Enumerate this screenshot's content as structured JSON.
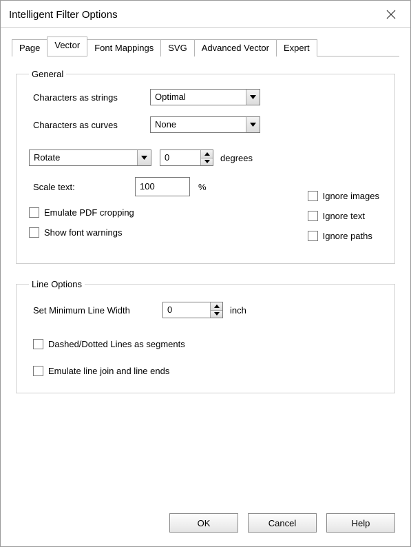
{
  "window": {
    "title": "Intelligent Filter Options"
  },
  "tabs": {
    "items": [
      {
        "label": "Page"
      },
      {
        "label": "Vector"
      },
      {
        "label": "Font Mappings"
      },
      {
        "label": "SVG"
      },
      {
        "label": "Advanced Vector"
      },
      {
        "label": "Expert"
      }
    ],
    "active_index": 1
  },
  "general": {
    "legend": "General",
    "chars_strings_label": "Characters as strings",
    "chars_strings_value": "Optimal",
    "chars_curves_label": "Characters as curves",
    "chars_curves_value": "None",
    "rotate_label": "Rotate",
    "rotate_degrees_value": "0",
    "degrees_label": "degrees",
    "scale_text_label": "Scale text:",
    "scale_text_value": "100",
    "scale_text_unit": "%",
    "emulate_pdf_cropping": "Emulate PDF cropping",
    "show_font_warnings": "Show font warnings",
    "ignore_images": "Ignore images",
    "ignore_text": "Ignore text",
    "ignore_paths": "Ignore paths"
  },
  "line_options": {
    "legend": "Line Options",
    "min_line_width_label": "Set Minimum Line Width",
    "min_line_width_value": "0",
    "min_line_width_unit": "inch",
    "dashed_segments": "Dashed/Dotted Lines as segments",
    "emulate_line_join": "Emulate line join and line ends"
  },
  "buttons": {
    "ok": "OK",
    "cancel": "Cancel",
    "help": "Help"
  }
}
